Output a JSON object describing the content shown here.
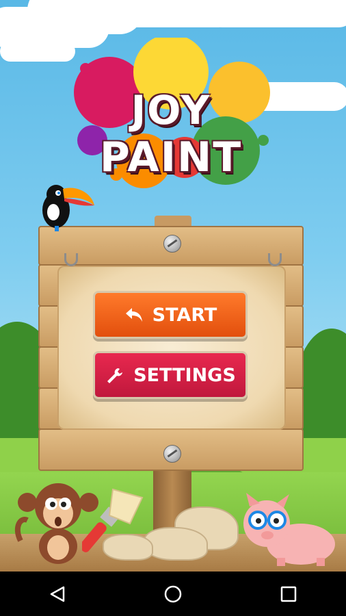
{
  "app": {
    "logo_line1": "JOY",
    "logo_line2": "PAINT"
  },
  "menu": {
    "start_label": "START",
    "settings_label": "SETTINGS"
  },
  "colors": {
    "start_button": "#e9561a",
    "settings_button": "#d21f46",
    "sky": "#6cc3ec",
    "grass": "#7fc242"
  },
  "icons": {
    "start": "undo-arrow-icon",
    "settings": "wrench-icon",
    "nav_back": "back-triangle-icon",
    "nav_home": "home-circle-icon",
    "nav_recent": "recent-square-icon"
  }
}
